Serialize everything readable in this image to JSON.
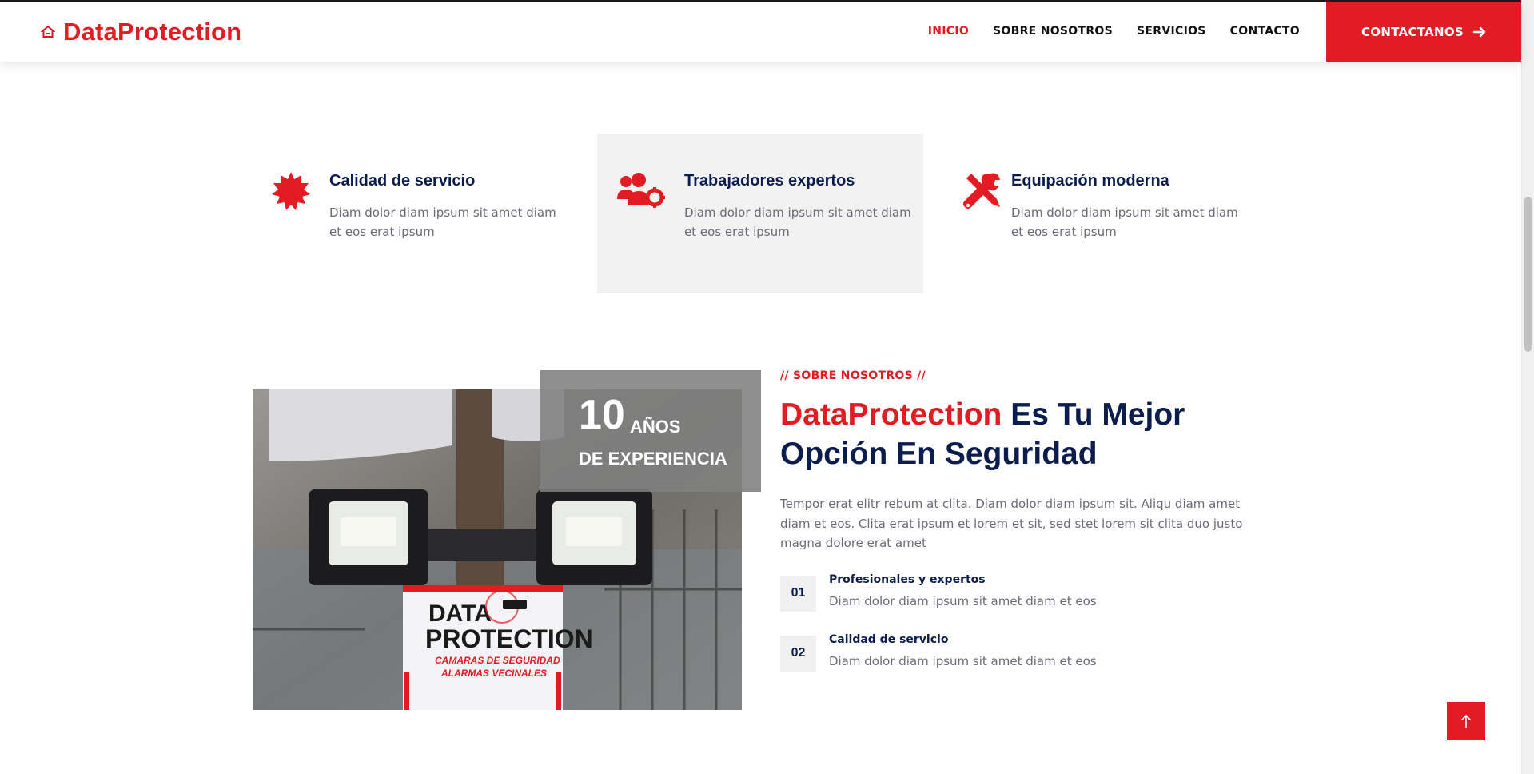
{
  "brand": {
    "name": "DataProtection",
    "icon": "home-icon",
    "color": "#e31b23"
  },
  "nav": {
    "links": [
      {
        "label": "INICIO",
        "active": true
      },
      {
        "label": "SOBRE NOSOTROS",
        "active": false
      },
      {
        "label": "SERVICIOS",
        "active": false
      },
      {
        "label": "CONTACTO",
        "active": false
      }
    ],
    "cta_label": "CONTACTANOS",
    "cta_icon": "arrow-right-icon"
  },
  "features": [
    {
      "icon": "starburst-icon",
      "title": "Calidad de servicio",
      "desc": "Diam dolor diam ipsum sit amet diam et eos erat ipsum",
      "highlight": false
    },
    {
      "icon": "users-cog-icon",
      "title": "Trabajadores expertos",
      "desc": "Diam dolor diam ipsum sit amet diam et eos erat ipsum",
      "highlight": true
    },
    {
      "icon": "tools-icon",
      "title": "Equipación moderna",
      "desc": "Diam dolor diam ipsum sit amet diam et eos erat ipsum",
      "highlight": false
    }
  ],
  "badge": {
    "number": "10",
    "unit": "AÑOS",
    "subtitle": "DE EXPERIENCIA"
  },
  "photo": {
    "sign_line1": "DATA",
    "sign_line2": "PROTECTION",
    "sign_line3": "CAMARAS DE SEGURIDAD",
    "sign_line4": "ALARMAS VECINALES"
  },
  "about": {
    "eyebrow": "// SOBRE NOSOTROS //",
    "title_accent": "DataProtection",
    "title_rest": " Es Tu Mejor Opción En Seguridad",
    "text": "Tempor erat elitr rebum at clita. Diam dolor diam ipsum sit. Aliqu diam amet diam et eos. Clita erat ipsum et lorem et sit, sed stet lorem sit clita duo justo magna dolore erat amet",
    "points": [
      {
        "num": "01",
        "title": "Profesionales y expertos",
        "desc": "Diam dolor diam ipsum sit amet diam et eos"
      },
      {
        "num": "02",
        "title": "Calidad de servicio",
        "desc": "Diam dolor diam ipsum sit amet diam et eos"
      }
    ]
  },
  "back_to_top_icon": "arrow-up-icon",
  "colors": {
    "accent": "#e31b23",
    "navy": "#0b1d4d",
    "muted": "#6b6a75",
    "panel": "#f2f2f2"
  }
}
